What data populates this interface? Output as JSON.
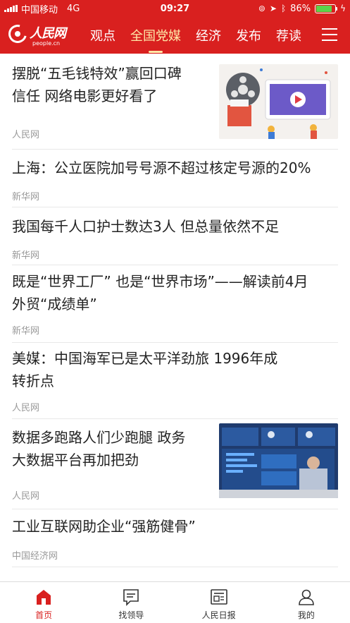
{
  "status_bar": {
    "carrier": "中国移动",
    "network": "4G",
    "time": "09:27",
    "battery": "86%",
    "battery_level": 0.86
  },
  "logo": {
    "text": "人民网",
    "sub": "people.cn"
  },
  "nav": {
    "tabs": [
      "观点",
      "全国党媒",
      "经济",
      "发布",
      "荐读"
    ],
    "active_index": 1
  },
  "feed": {
    "items": [
      {
        "title_lines": [
          "摆脱“五毛钱特效”赢回口碑",
          "信任 网络电影更好看了"
        ],
        "source": "人民网",
        "thumbnail": "movie-illustration"
      },
      {
        "title_lines": [
          "上海：公立医院加号号源不超过核定号源的20%"
        ],
        "source": "新华网"
      },
      {
        "title_lines": [
          "我国每千人口护士数达3人 但总量依然不足"
        ],
        "source": "新华网"
      },
      {
        "title_lines": [
          "既是“世界工厂” 也是“世界市场”——解读前4月",
          "外贸“成绩单”"
        ],
        "source": "新华网"
      },
      {
        "title_lines": [
          "美媒：中国海军已是太平洋劲旅 1996年成",
          "转折点"
        ],
        "source": "人民网"
      },
      {
        "title_lines": [
          "数据多跑路人们少跑腿 政务",
          "大数据平台再加把劲"
        ],
        "source": "人民网",
        "thumbnail": "big-data-screen-photo"
      },
      {
        "title_lines": [
          "工业互联网助企业“强筋健骨”"
        ],
        "source": "中国经济网"
      }
    ]
  },
  "tab_bar": {
    "tabs": [
      {
        "label": "首页",
        "icon": "home-icon"
      },
      {
        "label": "找领导",
        "icon": "message-icon"
      },
      {
        "label": "人民日报",
        "icon": "newspaper-icon"
      },
      {
        "label": "我的",
        "icon": "user-icon"
      }
    ],
    "active_index": 0
  },
  "colors": {
    "brand_red": "#d9201f",
    "active_nav": "#ffe9a8",
    "source_gray": "#999999"
  }
}
